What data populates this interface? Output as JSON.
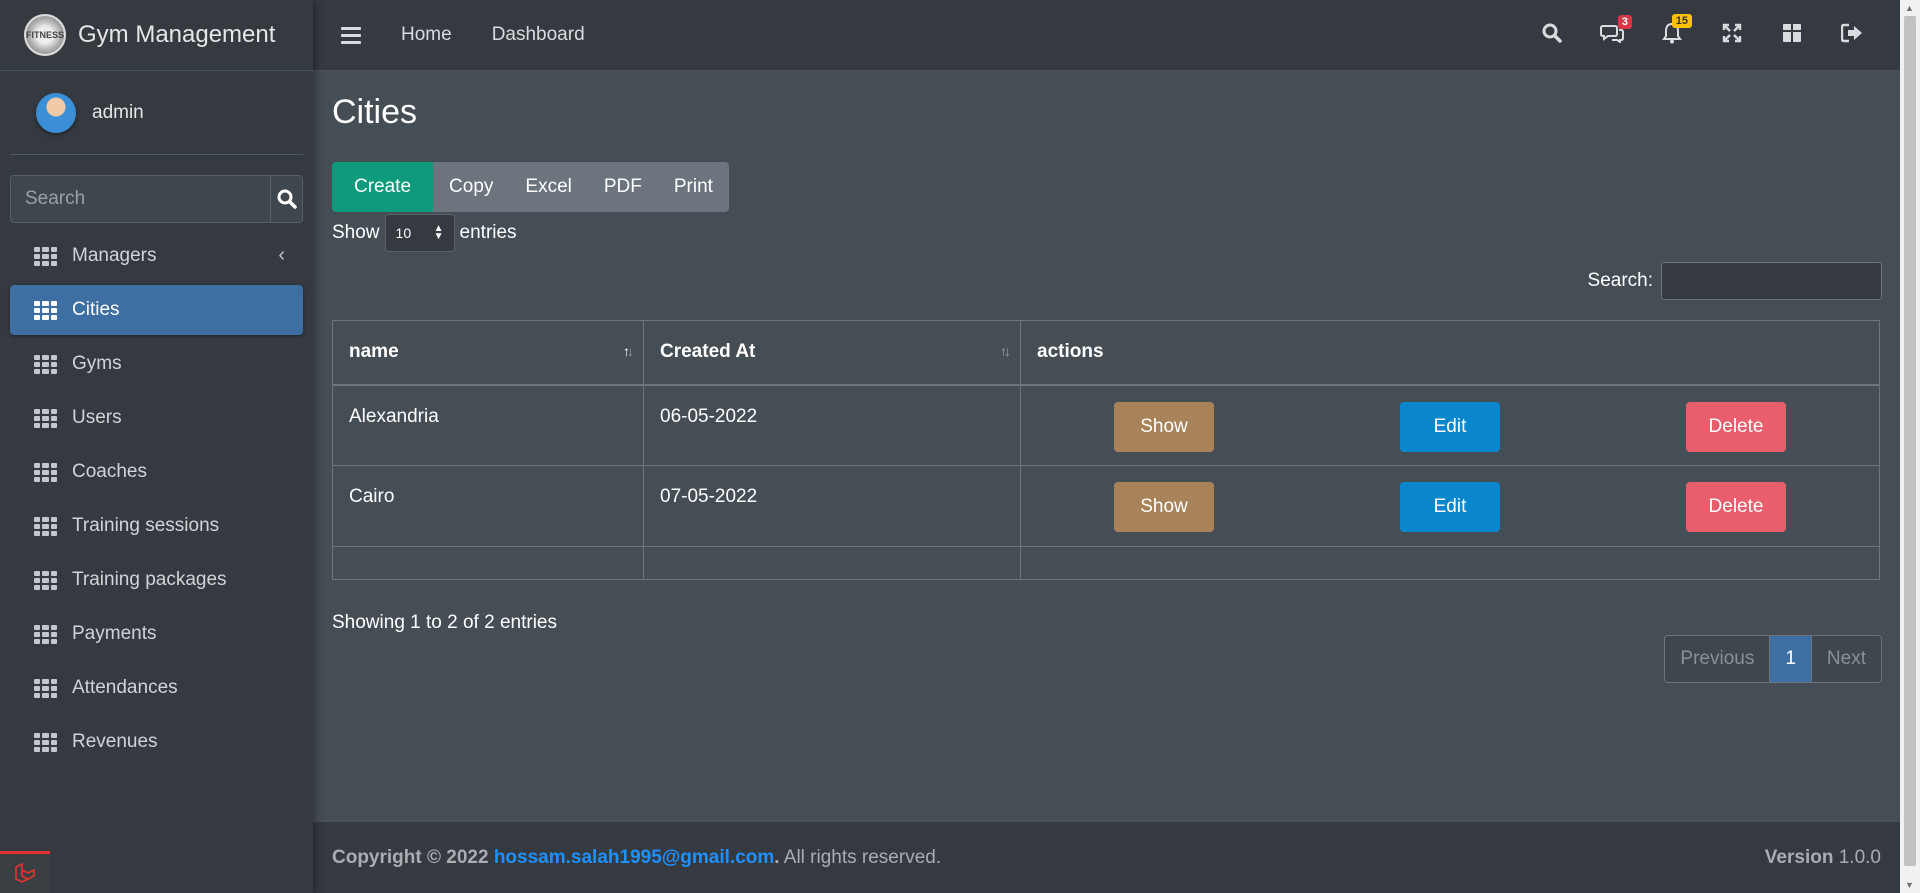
{
  "brand": {
    "title": "Gym Management",
    "logo_text": "FITNESS"
  },
  "user": {
    "name": "admin"
  },
  "sidebar": {
    "search_placeholder": "Search",
    "items": [
      {
        "label": "Managers"
      },
      {
        "label": "Cities"
      },
      {
        "label": "Gyms"
      },
      {
        "label": "Users"
      },
      {
        "label": "Coaches"
      },
      {
        "label": "Training sessions"
      },
      {
        "label": "Training packages"
      },
      {
        "label": "Payments"
      },
      {
        "label": "Attendances"
      },
      {
        "label": "Revenues"
      }
    ]
  },
  "topbar": {
    "home": "Home",
    "dashboard": "Dashboard",
    "messages_count": "3",
    "notifications_count": "15"
  },
  "page": {
    "title": "Cities"
  },
  "buttons": {
    "create": "Create",
    "copy": "Copy",
    "excel": "Excel",
    "pdf": "PDF",
    "print": "Print"
  },
  "length": {
    "show": "Show",
    "value": "10",
    "entries": "entries"
  },
  "filter": {
    "label": "Search:"
  },
  "table": {
    "headers": [
      "name",
      "Created At",
      "actions"
    ],
    "rows": [
      {
        "name": "Alexandria",
        "created": "06-05-2022"
      },
      {
        "name": "Cairo",
        "created": "07-05-2022"
      }
    ],
    "actions": {
      "show": "Show",
      "edit": "Edit",
      "delete": "Delete"
    }
  },
  "info": "Showing 1 to 2 of 2 entries",
  "pager": {
    "prev": "Previous",
    "current": "1",
    "next": "Next"
  },
  "footer": {
    "copyright": "Copyright © 2022",
    "email": "hossam.salah1995@gmail.com",
    "dot": ".",
    "rights": "All rights reserved.",
    "version_label": "Version",
    "version": "1.0.0"
  },
  "colors": {
    "accent": "#3d6fa3",
    "create": "#0e9a7d",
    "show": "#a8835a",
    "edit": "#0a87cc",
    "delete": "#e85e6c"
  }
}
